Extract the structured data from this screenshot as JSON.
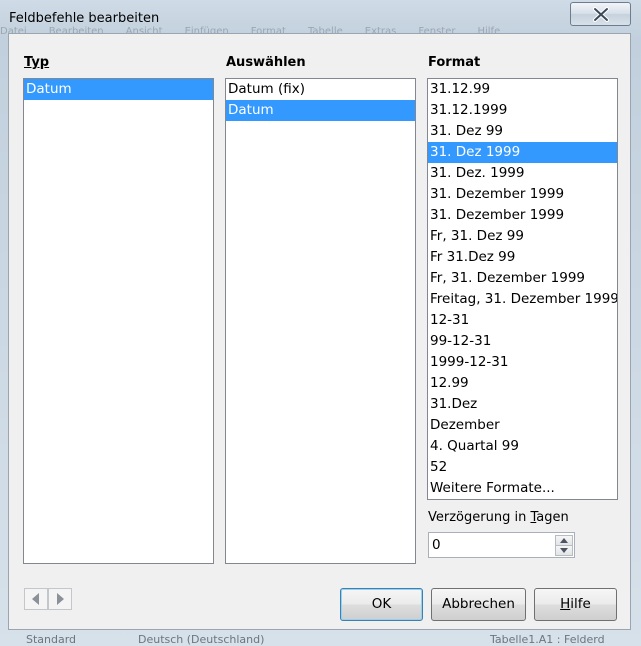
{
  "window": {
    "title": "Feldbefehle bearbeiten"
  },
  "background": {
    "menu": [
      "Datei",
      "Bearbeiten",
      "Ansicht",
      "Einfügen",
      "Format",
      "Tabelle",
      "Extras",
      "Fenster",
      "Hilfe"
    ],
    "status": [
      "Standard",
      "Deutsch (Deutschland)",
      "Tabelle1.A1 : Felderd"
    ]
  },
  "typ": {
    "label": "Typ",
    "items": [
      {
        "label": "Datum",
        "selected": true
      }
    ]
  },
  "auswahlen": {
    "label": "Auswählen",
    "items": [
      {
        "label": "Datum (fix)",
        "selected": false
      },
      {
        "label": "Datum",
        "selected": true
      }
    ]
  },
  "format": {
    "label": "Format",
    "items": [
      {
        "label": "31.12.99",
        "selected": false
      },
      {
        "label": "31.12.1999",
        "selected": false
      },
      {
        "label": "31. Dez 99",
        "selected": false
      },
      {
        "label": "31. Dez 1999",
        "selected": true
      },
      {
        "label": "31. Dez. 1999",
        "selected": false
      },
      {
        "label": "31. Dezember 1999",
        "selected": false
      },
      {
        "label": "31. Dezember 1999",
        "selected": false
      },
      {
        "label": "Fr, 31. Dez 99",
        "selected": false
      },
      {
        "label": "Fr 31.Dez 99",
        "selected": false
      },
      {
        "label": "Fr, 31. Dezember 1999",
        "selected": false
      },
      {
        "label": "Freitag, 31. Dezember 1999",
        "selected": false
      },
      {
        "label": "12-31",
        "selected": false
      },
      {
        "label": "99-12-31",
        "selected": false
      },
      {
        "label": "1999-12-31",
        "selected": false
      },
      {
        "label": "12.99",
        "selected": false
      },
      {
        "label": "31.Dez",
        "selected": false
      },
      {
        "label": "Dezember",
        "selected": false
      },
      {
        "label": "4. Quartal 99",
        "selected": false
      },
      {
        "label": "52",
        "selected": false
      },
      {
        "label": "Weitere Formate...",
        "selected": false
      }
    ]
  },
  "delay": {
    "label_prefix": "Verzögerung in ",
    "label_accel": "T",
    "label_suffix": "agen",
    "value": "0"
  },
  "buttons": {
    "ok": "OK",
    "cancel": "Abbrechen",
    "help_accel": "H",
    "help_rest": "ilfe"
  },
  "colors": {
    "selection": "#3399ff",
    "dialog": "#f0f0f0"
  }
}
